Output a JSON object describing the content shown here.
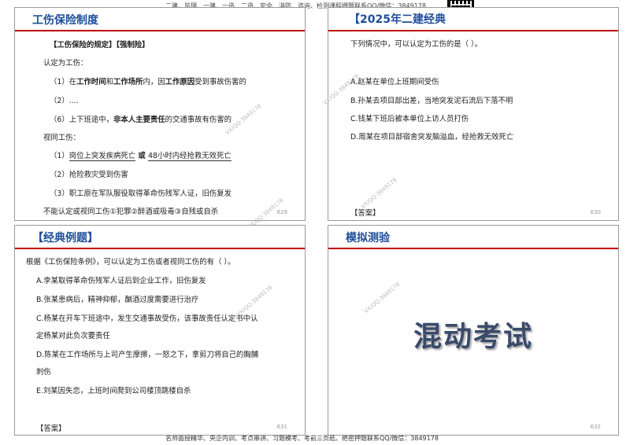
{
  "header": {
    "banner": "二建、监理、一建、一造、二造、安全、消防、咨询、检测课程押题联系QQ/微信：3849178"
  },
  "footer": {
    "banner": "名师面授精华、央企内训、考点串讲、习题模考、考前三页纸、绝密押题联系QQ/微信：3849178"
  },
  "watermark": "VX/QQ:3849178",
  "slide1": {
    "title": "工伤保险制度",
    "page": "629",
    "heading": "【工伤保险的规定】【强制险】",
    "l1": "认定为工伤：",
    "l2_pre": "（1）在",
    "l2_b1": "工作时间",
    "l2_mid1": "和",
    "l2_b2": "工作场所",
    "l2_mid2": "内，因",
    "l2_b3": "工作原因",
    "l2_post": "受到事故伤害的",
    "l3": "（2）....",
    "l4_pre": "（6）上下班途中，",
    "l4_b": "非本人主要责任",
    "l4_post": "的交通事故有伤害的",
    "l5": "视同工伤：",
    "l6_a": "（1）",
    "l6_u1": "岗位上突发疾病死亡",
    "l6_or": " 或 ",
    "l6_u2": "48小时内经抢救无效死亡",
    "l7": "（2）抢险救灾受到伤害",
    "l8": "（3）职工原在军队服役取得革命伤残军人证，旧伤复发",
    "l9": "不能认定或视同工伤①犯罪②醉酒或吸毒③自残或自杀"
  },
  "slide2": {
    "title": "【2025年二建经典",
    "page": "630",
    "q": "下列情况中，可以认定为工伤的是（ ）。",
    "a": "A.赵某在单位上班期间受伤",
    "b": "B.孙某去项目部出差，当地突发泥石流后下落不明",
    "c": "C.钱某下班后被本单位上访人员打伤",
    "d": "D.周某在项目部宿舍突发脑溢血，经抢救无效死亡",
    "answer": "【答案】"
  },
  "slide3": {
    "title": "【经典例题】",
    "page": "631",
    "q": "根据《工伤保险条例》，可以认定为工伤或者视同工伤的有（ ）。",
    "a": "A.李某取得革命伤残军人证后到企业工作，旧伤复发",
    "b": "B.张某患病后，精神抑郁，酗酒过度需要进行治疗",
    "c1": "C.杨某在开车下班途中，发生交通事故受伤，该事故责任认定书中认",
    "c2": "定杨某对此负次要责任",
    "d1": "D.陈某在工作场所与上司产生摩擦，一怒之下，拿剪刀将自己的胸脯",
    "d2": "刺伤",
    "e": "E.刘某因失恋，上班时间爬到公司楼顶跳楼自杀",
    "answer": "【答案】"
  },
  "slide4": {
    "title": "模拟测验",
    "page": "632",
    "big": "混动考试"
  }
}
